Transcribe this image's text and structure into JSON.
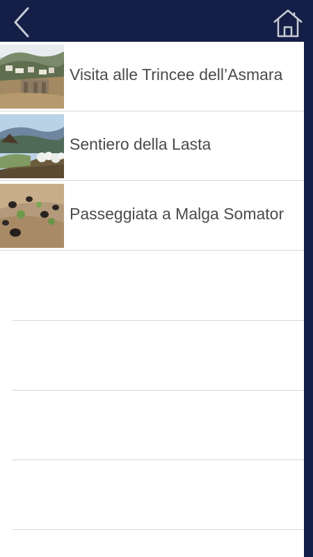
{
  "navbar": {
    "back_icon": "chevron-left-icon",
    "home_icon": "home-icon",
    "background": "#141e46",
    "icon_color": "#c9ccd6"
  },
  "list": {
    "items": [
      {
        "title": "Visita alle Trincee dell’Asmara",
        "thumbnail": "village-landscape-photo"
      },
      {
        "title": "Sentiero della Lasta",
        "thumbnail": "mountain-trail-photo"
      },
      {
        "title": "Passeggiata a Malga Somator",
        "thumbnail": "grazing-animals-photo"
      }
    ]
  }
}
